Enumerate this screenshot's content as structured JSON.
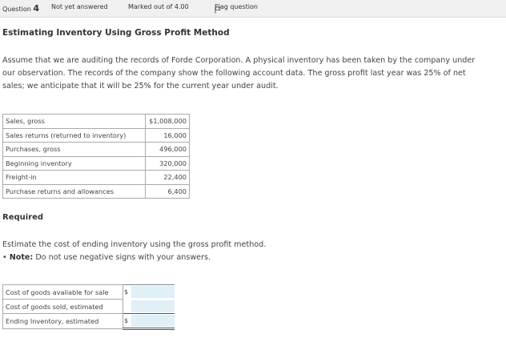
{
  "header": {
    "question_label": "Question",
    "question_number": "4",
    "status": "Not yet answered",
    "marks": "Marked out of 4.00",
    "flag": "Flag question",
    "icons": {
      "flag": "flag-icon"
    }
  },
  "title": "Estimating Inventory Using Gross Profit Method",
  "prompt": "Assume that we are auditing the records of Forde Corporation. A physical inventory has been taken by the company under our observation. The records of the company show the following account data. The gross profit last year was 25% of net sales; we anticipate that it will be 25% for the current year under audit.",
  "accounts": [
    {
      "label": "Sales, gross",
      "value": "$1,008,000"
    },
    {
      "label": "Sales returns (returned to inventory)",
      "value": "16,000"
    },
    {
      "label": "Purchases, gross",
      "value": "496,000"
    },
    {
      "label": "Beginning inventory",
      "value": "320,000"
    },
    {
      "label": "Freight-in",
      "value": "22,400"
    },
    {
      "label": "Purchase returns and allowances",
      "value": "6,400"
    }
  ],
  "required_heading": "Required",
  "instruction": "Estimate the cost of ending inventory using the gross profit method.",
  "note_label": "Note:",
  "note_text": "Do not use negative signs with your answers.",
  "answers": [
    {
      "label": "Cost of goods available for sale",
      "currency": "$",
      "value": ""
    },
    {
      "label": "Cost of goods sold, estimated",
      "currency": "",
      "value": ""
    },
    {
      "label": "Ending Inventory, estimated",
      "currency": "$",
      "value": ""
    }
  ],
  "colors": {
    "input_bg": "#dff0f7",
    "header_bg": "#f0f0f0"
  }
}
